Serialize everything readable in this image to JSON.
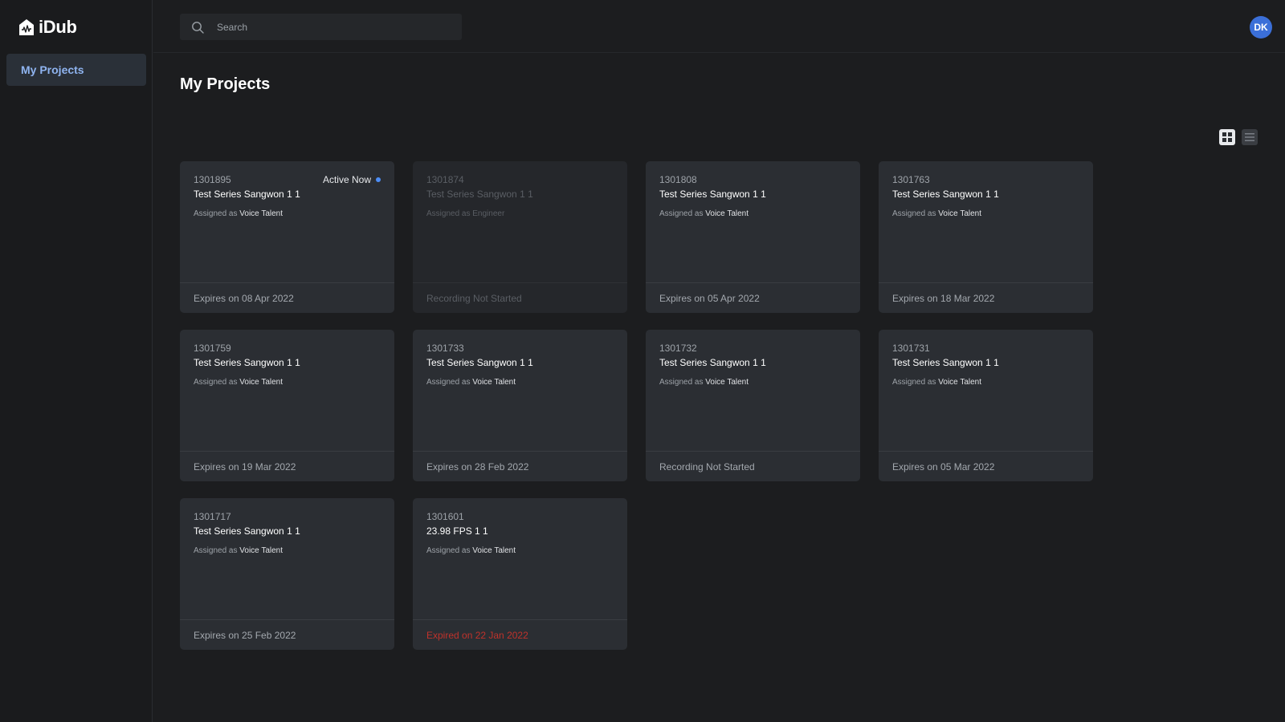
{
  "app": {
    "name": "iDub"
  },
  "sidebar": {
    "items": [
      {
        "label": "My Projects"
      }
    ]
  },
  "search": {
    "placeholder": "Search"
  },
  "user": {
    "initials": "DK"
  },
  "page": {
    "title": "My Projects"
  },
  "view": {
    "selected": "grid",
    "options": [
      "grid-view-icon",
      "list-view-icon"
    ]
  },
  "projects": [
    {
      "id": "1301895",
      "title": "Test Series Sangwon 1 1",
      "assigned_prefix": "Assigned as",
      "role": "Voice Talent",
      "status": "Expires on 08 Apr 2022",
      "active_label": "Active Now"
    },
    {
      "id": "1301874",
      "title": "Test Series Sangwon 1 1",
      "assigned_prefix": "Assigned as",
      "role": "Engineer",
      "status": "Recording Not Started"
    },
    {
      "id": "1301808",
      "title": "Test Series Sangwon 1 1",
      "assigned_prefix": "Assigned as",
      "role": "Voice Talent",
      "status": "Expires on 05 Apr 2022"
    },
    {
      "id": "1301763",
      "title": "Test Series Sangwon 1 1",
      "assigned_prefix": "Assigned as",
      "role": "Voice Talent",
      "status": "Expires on 18 Mar 2022"
    },
    {
      "id": "1301759",
      "title": "Test Series Sangwon 1 1",
      "assigned_prefix": "Assigned as",
      "role": "Voice Talent",
      "status": "Expires on 19 Mar 2022"
    },
    {
      "id": "1301733",
      "title": "Test Series Sangwon 1 1",
      "assigned_prefix": "Assigned as",
      "role": "Voice Talent",
      "status": "Expires on 28 Feb 2022"
    },
    {
      "id": "1301732",
      "title": "Test Series Sangwon 1 1",
      "assigned_prefix": "Assigned as",
      "role": "Voice Talent",
      "status": "Recording Not Started"
    },
    {
      "id": "1301731",
      "title": "Test Series Sangwon 1 1",
      "assigned_prefix": "Assigned as",
      "role": "Voice Talent",
      "status": "Expires on 05 Mar 2022"
    },
    {
      "id": "1301717",
      "title": "Test Series Sangwon 1 1",
      "assigned_prefix": "Assigned as",
      "role": "Voice Talent",
      "status": "Expires on 25 Feb 2022"
    },
    {
      "id": "1301601",
      "title": "23.98 FPS 1 1",
      "assigned_prefix": "Assigned as",
      "role": "Voice Talent",
      "status": "Expired on 22 Jan 2022"
    }
  ],
  "colors": {
    "accent": "#4d8ef7",
    "expired": "#c0322b",
    "avatar": "#3b6fd8",
    "nav_active_text": "#8fb4f0"
  }
}
